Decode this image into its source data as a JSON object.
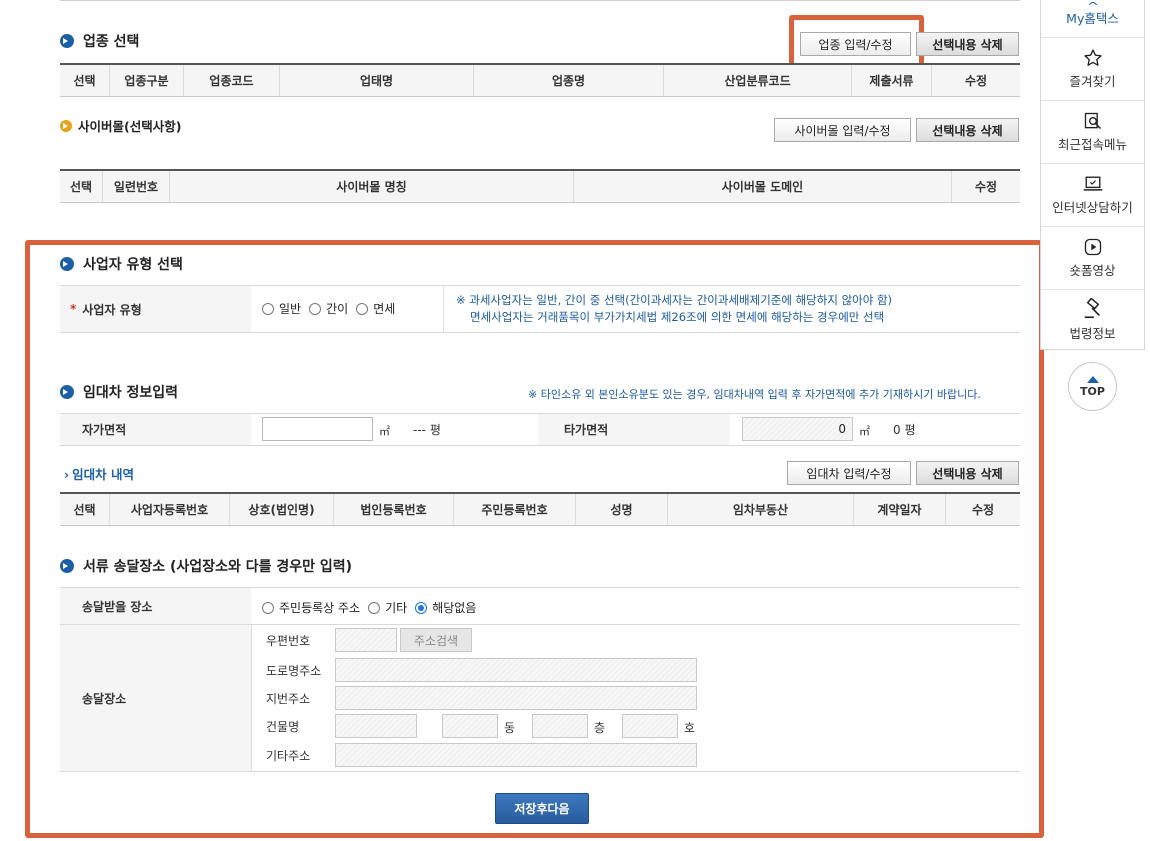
{
  "industry": {
    "title": "업종 선택",
    "btn_edit": "업종 입력/수정",
    "btn_delete": "선택내용 삭제",
    "columns": [
      "선택",
      "업종구분",
      "업종코드",
      "업태명",
      "업종명",
      "산업분류코드",
      "제출서류",
      "수정"
    ]
  },
  "cybermall": {
    "title": "사이버몰(선택사항)",
    "btn_edit": "사이버몰 입력/수정",
    "btn_delete": "선택내용 삭제",
    "columns": [
      "선택",
      "일련번호",
      "사이버몰 명칭",
      "사이버몰 도메인",
      "수정"
    ]
  },
  "business_type": {
    "title": "사업자 유형 선택",
    "required_mark": "*",
    "label": "사업자 유형",
    "options": [
      "일반",
      "간이",
      "면세"
    ],
    "notice_line1": "※ 과세사업자는 일반, 간이 중 선택(간이과세자는 간이과세배제기준에 해당하지 않아야 함)",
    "notice_line2": "면세사업자는 거래품목이 부가가치세법 제26조에 의한 면세에 해당하는 경우에만 선택"
  },
  "lease": {
    "title": "임대차 정보입력",
    "notice": "※ 타인소유 외 본인소유분도 있는 경우, 임대차내역 입력 후 자가면적에 추가 기재하시기 바랍니다.",
    "own_area_label": "자가면적",
    "own_area_unit": "㎡",
    "own_pyeong_value": "---",
    "own_pyeong_unit": "평",
    "other_area_label": "타가면적",
    "other_area_value": "0",
    "other_area_unit": "㎡",
    "other_pyeong_value": "0",
    "other_pyeong_unit": "평",
    "detail_title": "임대차 내역",
    "btn_edit": "임대차 입력/수정",
    "btn_delete": "선택내용 삭제",
    "columns": [
      "선택",
      "사업자등록번호",
      "상호(법인명)",
      "법인등록번호",
      "주민등록번호",
      "성명",
      "임차부동산",
      "계약일자",
      "수정"
    ]
  },
  "delivery": {
    "title": "서류 송달장소 (사업장소와 다를 경우만 입력)",
    "place_label": "송달받을 장소",
    "options": [
      "주민등록상 주소",
      "기타",
      "해당없음"
    ],
    "selected": "해당없음",
    "address_label": "송달장소",
    "postal_label": "우편번호",
    "search_btn": "주소검색",
    "road_label": "도로명주소",
    "lot_label": "지번주소",
    "building_label": "건물명",
    "dong": "동",
    "floor": "층",
    "ho": "호",
    "other_label": "기타주소"
  },
  "save_button": "저장후다음",
  "sidebar": {
    "items": [
      "My홈택스",
      "즐겨찾기",
      "최근접속메뉴",
      "인터넷상담하기",
      "숏폼영상",
      "법령정보"
    ],
    "top": "TOP"
  },
  "colors": {
    "highlight": "#d9623d",
    "primary": "#1c5fa6",
    "notice": "#1a5aa0"
  }
}
